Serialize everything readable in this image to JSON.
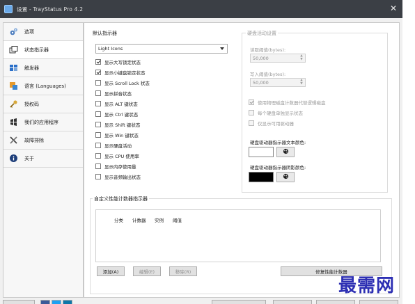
{
  "window": {
    "title": "设置 - TrayStatus Pro 4.2",
    "close_glyph": "✕"
  },
  "sidebar": {
    "items": [
      {
        "label": "选项",
        "icon": "gears-icon",
        "active": false
      },
      {
        "label": "状态指示器",
        "icon": "windows-icon",
        "active": true
      },
      {
        "label": "触发器",
        "icon": "trigger-icon",
        "active": false
      },
      {
        "label": "语言 (Languages)",
        "icon": "language-icon",
        "active": false
      },
      {
        "label": "授权码",
        "icon": "key-icon",
        "active": false
      },
      {
        "label": "我们的应用程序",
        "icon": "apps-icon",
        "active": false
      },
      {
        "label": "故障排除",
        "icon": "tools-icon",
        "active": false
      },
      {
        "label": "关于",
        "icon": "info-icon",
        "active": false
      }
    ]
  },
  "indicators": {
    "section_title": "默认指示器",
    "icon_set": "Light Icons",
    "checkboxes": [
      {
        "label": "显示大写锁定状态",
        "checked": true
      },
      {
        "label": "显示小键盘锁定状态",
        "checked": true
      },
      {
        "label": "显示 Scroll Lock 状态",
        "checked": false
      },
      {
        "label": "显示拼音状态",
        "checked": false
      },
      {
        "label": "显示 ALT 键状态",
        "checked": false
      },
      {
        "label": "显示 Ctrl 键状态",
        "checked": false
      },
      {
        "label": "显示 Shift 键状态",
        "checked": false
      },
      {
        "label": "显示 Win 键状态",
        "checked": false
      },
      {
        "label": "显示硬盘活动",
        "checked": false
      },
      {
        "label": "显示 CPU 使用率",
        "checked": false
      },
      {
        "label": "显示内存使用量",
        "checked": false
      },
      {
        "label": "显示音频输出状态",
        "checked": false
      }
    ]
  },
  "disk": {
    "section_title": "硬盘活动设置",
    "read_label": "读取阈值(bytes):",
    "read_value": "50,000",
    "write_label": "写入阈值(bytes):",
    "write_value": "50,000",
    "options": [
      {
        "label": "使用物理磁盘计数器代替逻辑磁盘",
        "checked": true
      },
      {
        "label": "每个硬盘单独显示状态",
        "checked": false
      },
      {
        "label": "仅显示可用驱动器",
        "checked": false
      }
    ],
    "text_color_label": "硬盘驱动器指示器文本颜色:",
    "text_color": "#ffffff",
    "shadow_color_label": "硬盘驱动器指示器阴影颜色:",
    "shadow_color": "#000000"
  },
  "counters": {
    "section_title": "自定义性能计数器指示器",
    "columns": [
      "分类",
      "计数器",
      "实例",
      "阈值"
    ],
    "add_label": "添加(A)",
    "edit_label": "编辑(E)",
    "remove_label": "移除(R)",
    "repair_label": "修复性能计数器"
  },
  "watermark": "最需网",
  "accent": "#2d2fb3"
}
